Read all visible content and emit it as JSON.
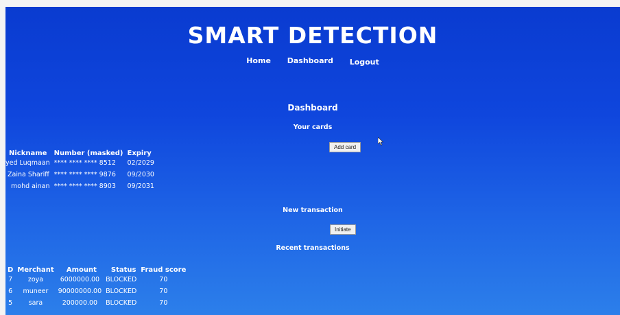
{
  "app": {
    "title": "SMART DETECTION"
  },
  "nav": {
    "home": "Home",
    "dashboard": "Dashboard",
    "logout": "Logout"
  },
  "dashboard": {
    "heading": "Dashboard",
    "cards_heading": "Your cards",
    "add_card_label": "Add card"
  },
  "cards": {
    "headers": [
      "Nickname",
      "Number (masked)",
      "Expiry"
    ],
    "rows": [
      [
        "yed Luqmaan",
        "**** **** **** 8512",
        "02/2029"
      ],
      [
        "Zaina Shariff",
        "**** **** **** 9876",
        "09/2030"
      ],
      [
        "mohd ainan",
        "**** **** **** 8903",
        "09/2031"
      ]
    ]
  },
  "transaction": {
    "heading": "New transaction",
    "initiate_label": "Initiate",
    "recent_heading": "Recent transactions"
  },
  "transactions": {
    "headers": [
      "D",
      "Merchant",
      "Amount",
      "Status",
      "Fraud score"
    ],
    "rows": [
      [
        "7",
        "zoya",
        "6000000.00",
        "BLOCKED",
        "70"
      ],
      [
        "6",
        "muneer",
        "90000000.00",
        "BLOCKED",
        "70"
      ],
      [
        "5",
        "sara",
        "200000.00",
        "BLOCKED",
        "70"
      ]
    ]
  }
}
